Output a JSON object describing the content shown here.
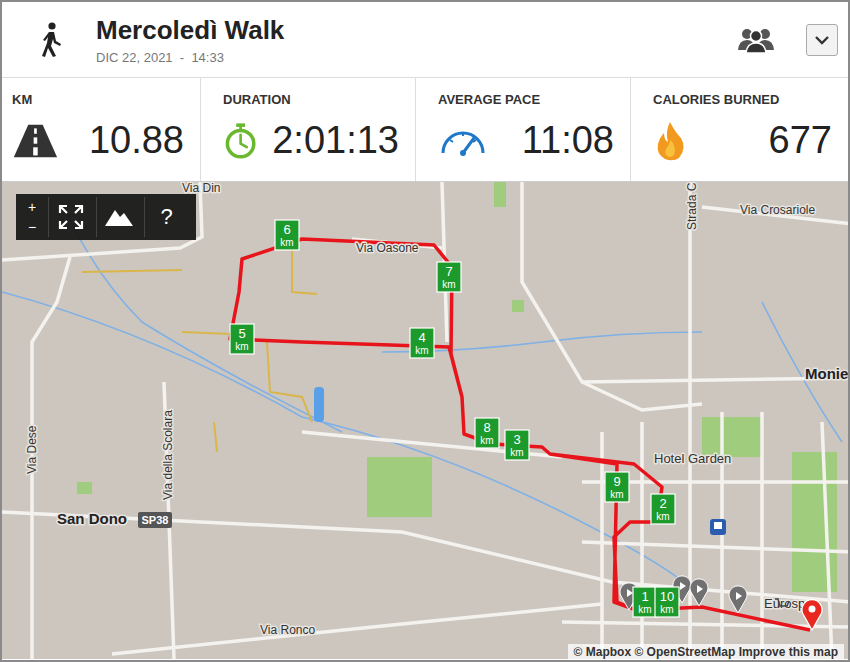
{
  "activity": {
    "title": "Mercoledì Walk",
    "date": "DIC 22, 2021  -  14:33"
  },
  "stats": [
    {
      "kind": "distance",
      "label": "KM",
      "value": "10.88"
    },
    {
      "kind": "duration",
      "label": "DURATION",
      "value": "2:01:13"
    },
    {
      "kind": "pace",
      "label": "AVERAGE PACE",
      "value": "11:08"
    },
    {
      "kind": "calories",
      "label": "CALORIES BURNED",
      "value": "677"
    }
  ],
  "map": {
    "controls": {
      "zoom_in": "+",
      "zoom_out": "−",
      "help": "?"
    },
    "labels": [
      {
        "kind": "street",
        "text": "Via Din"
      },
      {
        "kind": "street",
        "text": "Via Crosariole"
      },
      {
        "kind": "street-vertical",
        "text": "Strada C"
      },
      {
        "kind": "street",
        "text": "Via Oasone"
      },
      {
        "kind": "town",
        "text": "Monie"
      },
      {
        "kind": "poi",
        "text": "Hotel Garden"
      },
      {
        "kind": "town",
        "text": "San Dono"
      },
      {
        "kind": "shield",
        "text": "SP38"
      },
      {
        "kind": "street-vertical",
        "text": "Via Dese"
      },
      {
        "kind": "street-vertical",
        "text": "Via della Scolara"
      },
      {
        "kind": "street",
        "text": "Via Ronco"
      },
      {
        "kind": "poi",
        "text": "Eurospa"
      }
    ],
    "km_markers": [
      {
        "number": "1",
        "unit": "km"
      },
      {
        "number": "2",
        "unit": "km"
      },
      {
        "number": "3",
        "unit": "km"
      },
      {
        "number": "4",
        "unit": "km"
      },
      {
        "number": "5",
        "unit": "km"
      },
      {
        "number": "6",
        "unit": "km"
      },
      {
        "number": "7",
        "unit": "km"
      },
      {
        "number": "8",
        "unit": "km"
      },
      {
        "number": "9",
        "unit": "km"
      },
      {
        "number": "10",
        "unit": "km"
      }
    ],
    "attribution": "© Mapbox © OpenStreetMap Improve this map"
  }
}
